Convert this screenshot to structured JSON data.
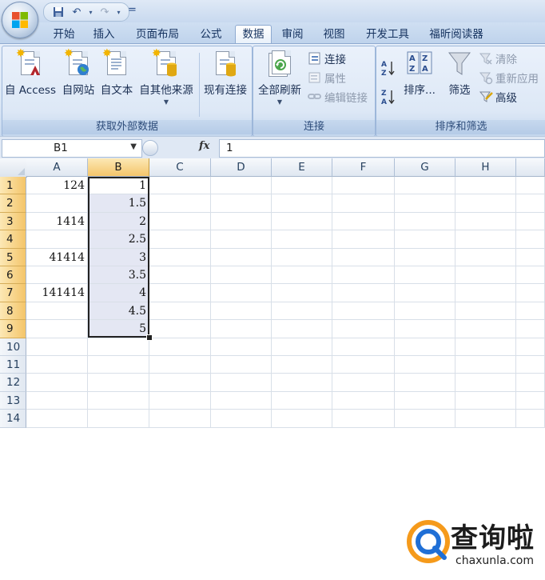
{
  "titlebar": {
    "qat": {
      "save": "save-icon",
      "undo": "undo-icon",
      "redo": "redo-icon",
      "customize": "="
    }
  },
  "tabs": [
    "开始",
    "插入",
    "页面布局",
    "公式",
    "数据",
    "审阅",
    "视图",
    "开发工具",
    "福昕阅读器"
  ],
  "active_tab": "数据",
  "ribbon": {
    "groups": {
      "external": {
        "label": "获取外部数据",
        "buttons": [
          "自 Access",
          "自网站",
          "自文本",
          "自其他来源",
          "现有连接"
        ]
      },
      "connections": {
        "label": "连接",
        "refresh_all": "全部刷新",
        "connections": "连接",
        "properties": "属性",
        "edit_links": "编辑链接"
      },
      "sort_filter": {
        "label": "排序和筛选",
        "sort_az": "A→Z",
        "sort_za": "Z→A",
        "sort": "排序...",
        "filter": "筛选",
        "clear": "清除",
        "reapply": "重新应用",
        "advanced": "高级"
      }
    }
  },
  "formula_bar": {
    "name_box": "B1",
    "fx": "fx",
    "formula": "1"
  },
  "grid": {
    "columns": [
      "A",
      "B",
      "C",
      "D",
      "E",
      "F",
      "G",
      "H"
    ],
    "rows": [
      "1",
      "2",
      "3",
      "4",
      "5",
      "6",
      "7",
      "8",
      "9",
      "10",
      "11",
      "12",
      "13",
      "14"
    ],
    "selected_column": "B",
    "selected_rows": [
      "1",
      "2",
      "3",
      "4",
      "5",
      "6",
      "7",
      "8",
      "9"
    ],
    "colA": [
      "124",
      "",
      "1414",
      "",
      "41414",
      "",
      "141414",
      "",
      ""
    ],
    "colB": [
      "1",
      "1.5",
      "2",
      "2.5",
      "3",
      "3.5",
      "4",
      "4.5",
      "5"
    ]
  },
  "watermark": {
    "text": "查询啦",
    "sub": "chaxunla.com"
  },
  "colors": {
    "accent": "#f4c56a",
    "ribbon": "#dbe7f6",
    "selection": "#e4e7f3"
  }
}
